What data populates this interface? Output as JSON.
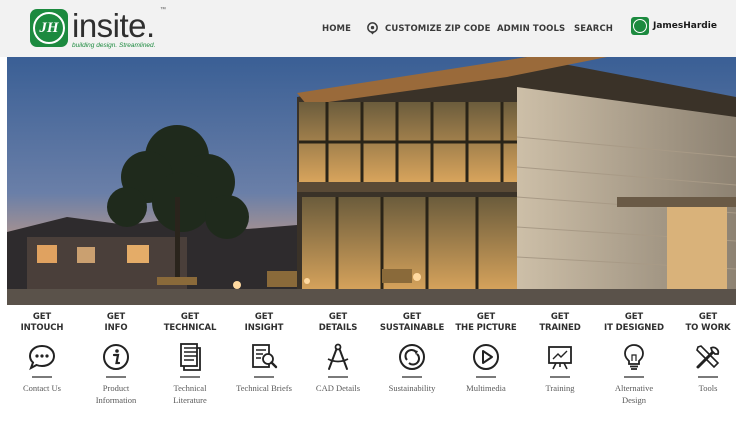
{
  "header": {
    "logo": {
      "word": "insite.",
      "trademark": "™",
      "tagline": "building design. Streamlined."
    },
    "nav": [
      {
        "label": "HOME"
      },
      {
        "label": "CUSTOMIZE ZIP CODE",
        "icon": "location-pin-icon"
      },
      {
        "label": "ADMIN TOOLS"
      },
      {
        "label": "SEARCH"
      }
    ],
    "brand": {
      "label": "JamesHardie",
      "icon": "jameshardie-logo-icon"
    }
  },
  "hero": {
    "slides": 4,
    "active_slide": 4,
    "description": "modern building with glass facade at dusk"
  },
  "items": [
    {
      "title": [
        "GET",
        "INTOUCH"
      ],
      "label": [
        "Contact Us"
      ],
      "icon": "chat-bubble-icon"
    },
    {
      "title": [
        "GET",
        "INFO"
      ],
      "label": [
        "Product",
        "Information"
      ],
      "icon": "info-icon"
    },
    {
      "title": [
        "GET",
        "TECHNICAL"
      ],
      "label": [
        "Technical",
        "Literature"
      ],
      "icon": "document-stack-icon"
    },
    {
      "title": [
        "GET",
        "INSIGHT"
      ],
      "label": [
        "Technical Briefs"
      ],
      "icon": "document-search-icon"
    },
    {
      "title": [
        "GET",
        "DETAILS"
      ],
      "label": [
        "CAD Details"
      ],
      "icon": "drafting-compass-icon"
    },
    {
      "title": [
        "GET",
        "SUSTAINABLE"
      ],
      "label": [
        "Sustainability"
      ],
      "icon": "recycle-icon"
    },
    {
      "title": [
        "GET",
        "THE PICTURE"
      ],
      "label": [
        "Multimedia"
      ],
      "icon": "play-icon"
    },
    {
      "title": [
        "GET",
        "TRAINED"
      ],
      "label": [
        "Training"
      ],
      "icon": "presentation-screen-icon"
    },
    {
      "title": [
        "GET",
        "IT DESIGNED"
      ],
      "label": [
        "Alternative",
        "Design"
      ],
      "icon": "lightbulb-icon"
    },
    {
      "title": [
        "GET",
        "TO WORK"
      ],
      "label": [
        "Tools"
      ],
      "icon": "tools-icon"
    }
  ],
  "colors": {
    "brand_green": "#1c8a3f",
    "text_dark": "#303030",
    "topbar_bg": "#f2f2f2"
  }
}
